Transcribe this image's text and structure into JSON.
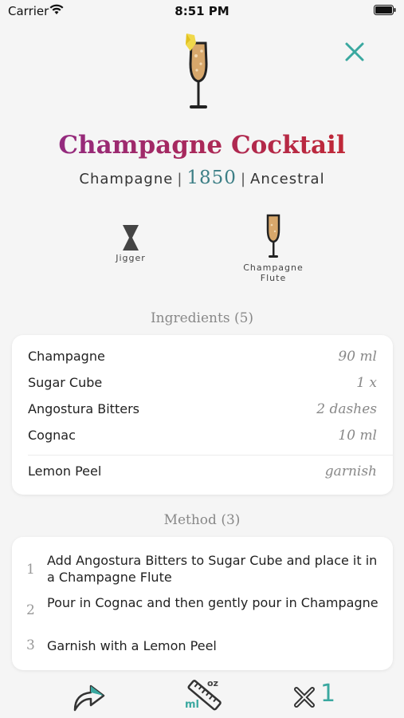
{
  "status": {
    "carrier": "Carrier",
    "time": "8:51 PM"
  },
  "drink": {
    "title": "Champagne Cocktail",
    "spirit": "Champagne",
    "year": "1850",
    "category": "Ancestral",
    "separator": "|"
  },
  "tools": [
    {
      "label": "Jigger",
      "icon": "jigger-icon"
    },
    {
      "label": "Champagne Flute",
      "icon": "champagne-flute-icon"
    }
  ],
  "ingredients": {
    "title": "Ingredients (5)",
    "items": [
      {
        "name": "Champagne",
        "amount": "90 ml"
      },
      {
        "name": "Sugar Cube",
        "amount": "1 x"
      },
      {
        "name": "Angostura Bitters",
        "amount": "2 dashes"
      },
      {
        "name": "Cognac",
        "amount": "10 ml"
      }
    ],
    "garnish": {
      "name": "Lemon Peel",
      "amount": "garnish"
    }
  },
  "method": {
    "title": "Method (3)",
    "steps": [
      {
        "num": "1",
        "text": "Add Angostura Bitters to Sugar Cube and place it in a Champagne Flute"
      },
      {
        "num": "2",
        "text": "Pour in Cognac and then gently pour in Champagne"
      },
      {
        "num": "3",
        "text": "Garnish with a Lemon Peel"
      }
    ]
  },
  "toolbar": {
    "unit_metric": "ml",
    "unit_imperial": "oz",
    "multiplier": "1"
  },
  "colors": {
    "accent": "#3aa8a0",
    "title_start": "#8a2a8e",
    "title_end": "#c8282a",
    "year": "#3d7f86"
  }
}
